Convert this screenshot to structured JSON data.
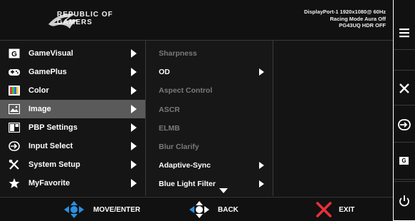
{
  "header": {
    "brand_line1": "REPUBLIC OF",
    "brand_line2": "GAMERS",
    "status_line1": "DisplayPort-1 1920x1080@ 60Hz",
    "status_line2": "Racing Mode Aura Off",
    "status_line3": "PG43UQ HDR OFF"
  },
  "main_menu": [
    {
      "label": "GameVisual",
      "icon": "gamevisual-icon"
    },
    {
      "label": "GamePlus",
      "icon": "gamepad-icon"
    },
    {
      "label": "Color",
      "icon": "color-icon"
    },
    {
      "label": "Image",
      "icon": "image-icon",
      "selected": true
    },
    {
      "label": "PBP Settings",
      "icon": "pbp-icon"
    },
    {
      "label": "Input Select",
      "icon": "input-icon"
    },
    {
      "label": "System Setup",
      "icon": "tools-icon"
    },
    {
      "label": "MyFavorite",
      "icon": "star-icon"
    }
  ],
  "submenu": [
    {
      "label": "Sharpness",
      "enabled": false
    },
    {
      "label": "OD",
      "enabled": true,
      "has_arrow": true
    },
    {
      "label": "Aspect Control",
      "enabled": false
    },
    {
      "label": "ASCR",
      "enabled": false
    },
    {
      "label": "ELMB",
      "enabled": false
    },
    {
      "label": "Blur Clarify",
      "enabled": false
    },
    {
      "label": "Adaptive-Sync",
      "enabled": true,
      "has_arrow": true
    },
    {
      "label": "Blue Light Filter",
      "enabled": true,
      "has_arrow": true
    }
  ],
  "footer": {
    "move_label": "MOVE/ENTER",
    "back_label": "BACK",
    "exit_label": "EXIT"
  },
  "side_buttons": [
    "menu-icon",
    "close-icon",
    "input-select-icon",
    "gamevisual-icon",
    "power-icon"
  ],
  "side_g_label": "G",
  "menu_g_label": "G",
  "colors": {
    "accent_blue": "#2b8fe0",
    "exit_red": "#e8303a",
    "selected_bg": "#5a5a5a",
    "disabled_text": "#7a7a7a"
  }
}
